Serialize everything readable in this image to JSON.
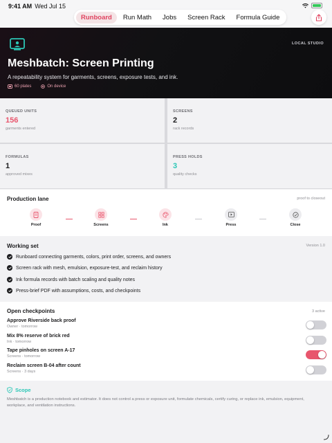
{
  "status_bar": {
    "time": "9:41 AM",
    "date": "Wed Jul 15"
  },
  "nav": {
    "tabs": [
      {
        "label": "Runboard",
        "active": true
      },
      {
        "label": "Run Math",
        "active": false
      },
      {
        "label": "Jobs",
        "active": false
      },
      {
        "label": "Screen Rack",
        "active": false
      },
      {
        "label": "Formula Guide",
        "active": false
      }
    ]
  },
  "hero": {
    "badge": "LOCAL STUDIO",
    "title": "Meshbatch: Screen Printing",
    "subtitle": "A repeatability system for garments, screens, exposure tests, and ink.",
    "meta_plates": "60 plates",
    "meta_device": "On device"
  },
  "stats": [
    {
      "label": "QUEUED UNITS",
      "value": "156",
      "note": "garments entered",
      "color": "#e8566d"
    },
    {
      "label": "SCREENS",
      "value": "2",
      "note": "rack records",
      "color": "#111111"
    },
    {
      "label": "FORMULAS",
      "value": "1",
      "note": "approved mixes",
      "color": "#111111"
    },
    {
      "label": "PRESS HOLDS",
      "value": "3",
      "note": "quality checks",
      "color": "#2cc7b6"
    }
  ],
  "production_lane": {
    "title": "Production lane",
    "caption": "proof to closeout",
    "steps": [
      {
        "label": "Proof",
        "icon": "document-icon"
      },
      {
        "label": "Screens",
        "icon": "grid-icon"
      },
      {
        "label": "Ink",
        "icon": "palette-icon"
      },
      {
        "label": "Press",
        "icon": "play-icon"
      },
      {
        "label": "Close",
        "icon": "checkmark-icon"
      }
    ]
  },
  "working_set": {
    "title": "Working set",
    "version": "Version 1.0",
    "items": [
      "Runboard connecting garments, colors, print order, screens, and owners",
      "Screen rack with mesh, emulsion, exposure-test, and reclaim history",
      "Ink formula records with batch scaling and quality notes",
      "Press-brief PDF with assumptions, costs, and checkpoints"
    ]
  },
  "checkpoints": {
    "title": "Open checkpoints",
    "count": "3 active",
    "items": [
      {
        "name": "Approve Riverside back proof",
        "meta": "Owner · tomorrow",
        "on": false
      },
      {
        "name": "Mix 8% reserve of brick red",
        "meta": "Ink · tomorrow",
        "on": false
      },
      {
        "name": "Tape pinholes on screen A-17",
        "meta": "Screens · tomorrow",
        "on": true
      },
      {
        "name": "Reclaim screen B-04 after count",
        "meta": "Screens · 3 days",
        "on": false
      }
    ]
  },
  "scope": {
    "title": "Scope",
    "text": "Meshbatch is a production notebook and estimator. It does not control a press or exposure unit, formulate chemicals, certify curing, or replace ink, emulsion, equipment, workplace, and ventilation instructions."
  },
  "colors": {
    "accent": "#e8566d",
    "teal": "#2cc7b6",
    "toggle_off": "#d1d1d6"
  }
}
